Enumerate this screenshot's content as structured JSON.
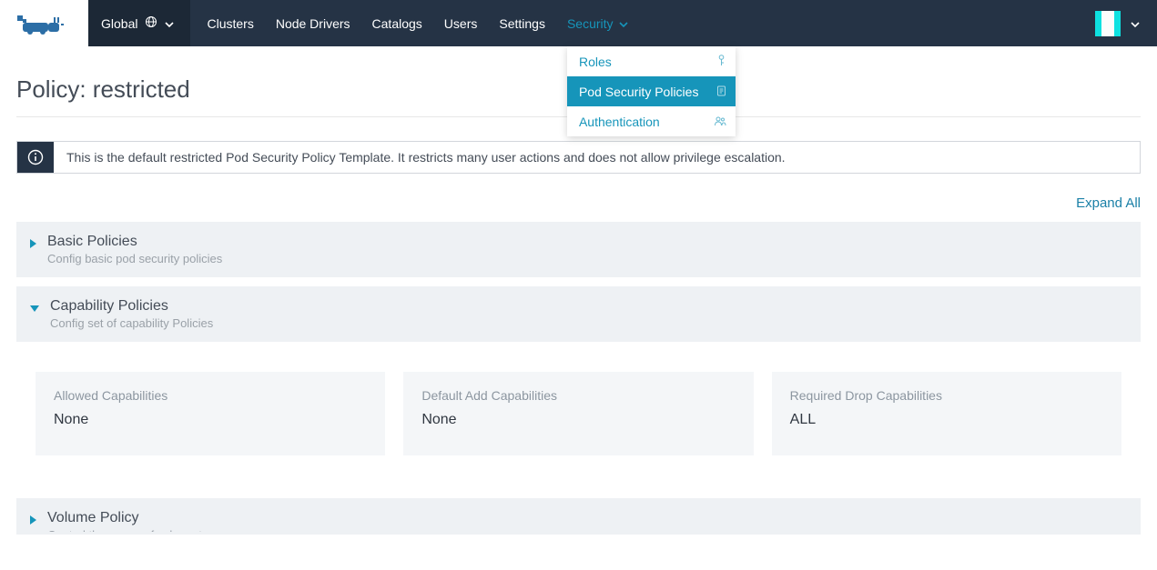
{
  "scope": {
    "label": "Global"
  },
  "nav": {
    "clusters": "Clusters",
    "node_drivers": "Node Drivers",
    "catalogs": "Catalogs",
    "users": "Users",
    "settings": "Settings",
    "security": "Security"
  },
  "security_menu": {
    "roles": "Roles",
    "pod_security_policies": "Pod Security Policies",
    "authentication": "Authentication"
  },
  "page": {
    "title": "Policy: restricted",
    "banner": "This is the default restricted Pod Security Policy Template. It restricts many user actions and does not allow privilege escalation.",
    "expand_all": "Expand All"
  },
  "sections": {
    "basic": {
      "title": "Basic Policies",
      "sub": "Config basic pod security policies"
    },
    "capability": {
      "title": "Capability Policies",
      "sub": "Config set of capability Policies",
      "cards": {
        "allowed": {
          "label": "Allowed Capabilities",
          "value": "None"
        },
        "default": {
          "label": "Default Add Capabilities",
          "value": "None"
        },
        "required": {
          "label": "Required Drop Capabilities",
          "value": "ALL"
        }
      }
    },
    "volume": {
      "title": "Volume Policy",
      "sub": "Control the usage of volume types"
    }
  },
  "avatar_colors": [
    "#0ee1e1",
    "#fcfcfc",
    "#fcfcfc",
    "#0ee1e1",
    "#0ee1e1",
    "#fcfcfc",
    "#fcfcfc",
    "#0ee1e1"
  ]
}
